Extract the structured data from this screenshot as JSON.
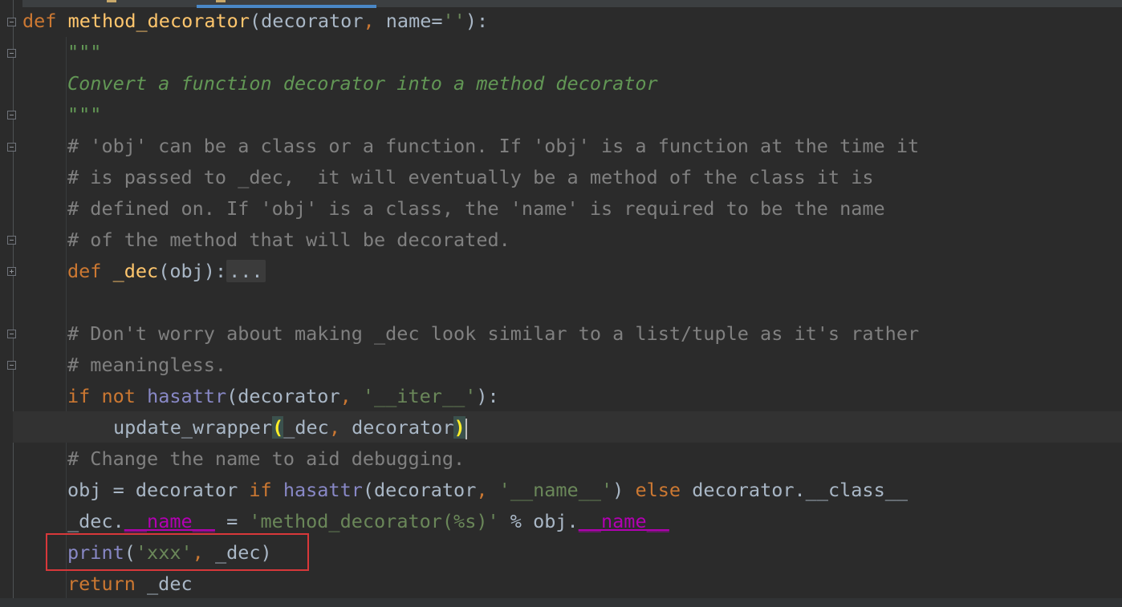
{
  "editor": {
    "language": "python",
    "colors": {
      "background": "#2b2b2b",
      "keyword": "#cc7832",
      "function_name": "#ffc66d",
      "string": "#6a8759",
      "docstring": "#629755",
      "comment": "#808080",
      "builtin": "#8888c6",
      "magic": "#b200b2",
      "default_text": "#a9b7c6",
      "annotation_box": "#d8383a"
    },
    "lines": {
      "l1": {
        "kw": "def",
        "fn": "method_decorator",
        "p1": "(decorator",
        "comma": ",",
        "p2": " name=",
        "str": "''",
        "end": "):"
      },
      "l2": {
        "doc": "\"\"\""
      },
      "l3": {
        "doc": "Convert a function decorator into a method decorator"
      },
      "l4": {
        "doc": "\"\"\""
      },
      "l5": {
        "cmt": "# 'obj' can be a class or a function. If 'obj' is a function at the time it"
      },
      "l6": {
        "cmt": "# is passed to _dec,  it will eventually be a method of the class it is"
      },
      "l7": {
        "cmt": "# defined on. If 'obj' is a class, the 'name' is required to be the name"
      },
      "l8": {
        "cmt": "# of the method that will be decorated."
      },
      "l9": {
        "kw": "def",
        "fn": "_dec",
        "rest": "(obj):",
        "folded": "..."
      },
      "l11": {
        "cmt": "# Don't worry about making _dec look similar to a list/tuple as it's rather"
      },
      "l12": {
        "cmt": "# meaningless."
      },
      "l13": {
        "kw1": "if",
        "kw2": "not",
        "builtin": "hasattr",
        "a": "(decorator",
        "comma": ",",
        "str": "'__iter__'",
        "end": "):"
      },
      "l14": {
        "call": "update_wrapper",
        "open": "(",
        "args": "_dec",
        "comma": ",",
        "arg2": " decorator",
        "close": ")"
      },
      "l15": {
        "cmt": "# Change the name to aid debugging."
      },
      "l16": {
        "a": "obj = decorator ",
        "kw1": "if",
        "builtin": "hasattr",
        "b": "(decorator",
        "comma": ",",
        "str": "'__name__'",
        "c": ") ",
        "kw2": "else",
        "d": " decorator.__class__"
      },
      "l17": {
        "a": "_dec.",
        "magic1": "__name__",
        "b": " = ",
        "str": "'method_decorator(%s)'",
        "c": " % obj.",
        "magic2": "__name__"
      },
      "l18": {
        "builtin": "print",
        "open": "(",
        "str": "'xxx'",
        "comma": ",",
        "rest": " _dec)"
      },
      "l19": {
        "kw": "return",
        "rest": " _dec"
      }
    }
  }
}
